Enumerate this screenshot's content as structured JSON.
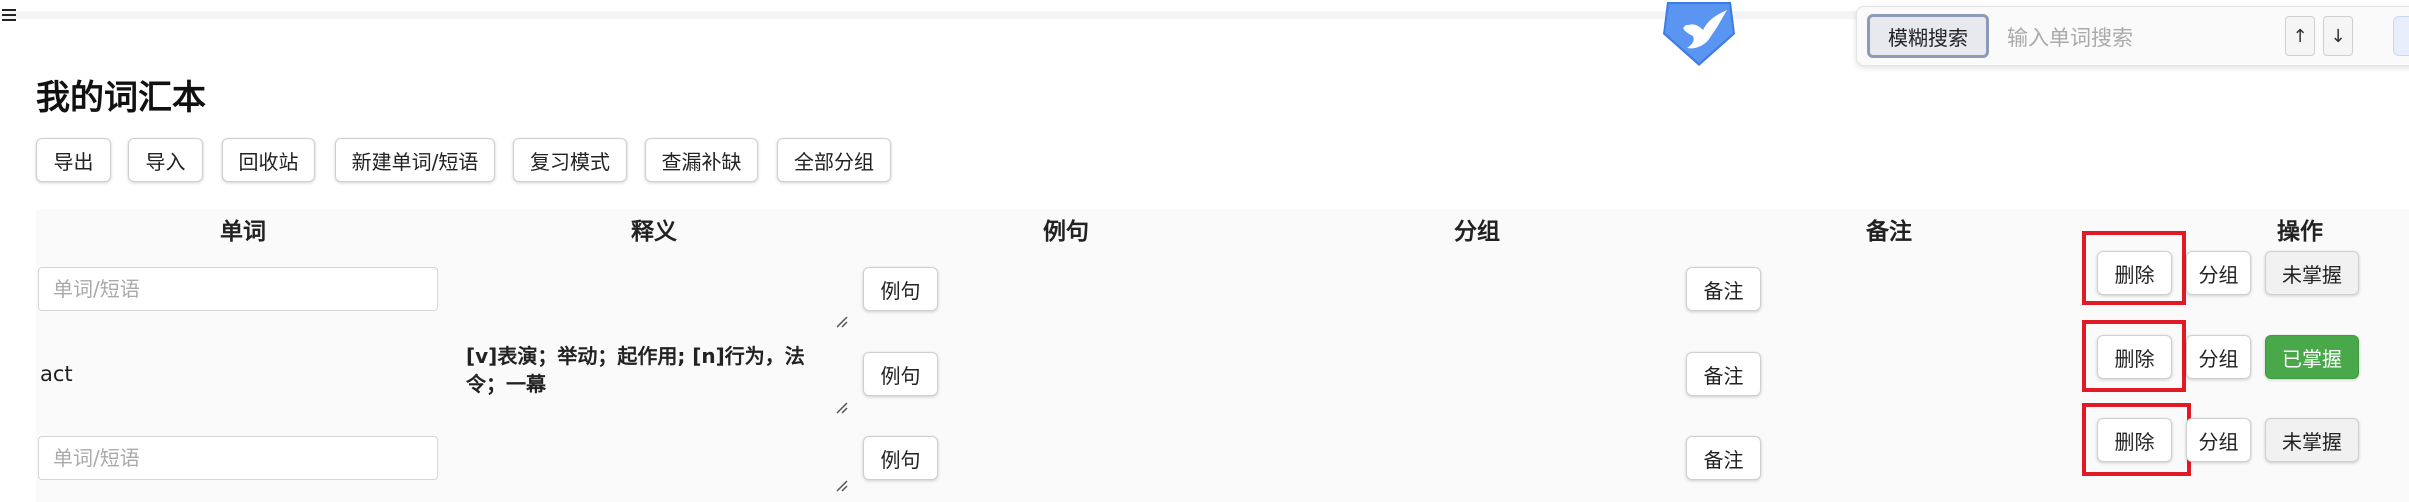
{
  "header": {
    "menu_icon": "hamburger-menu-icon",
    "logo_icon": "bird-shield-logo-icon",
    "search": {
      "fuzzy_label": "模糊搜索",
      "placeholder": "输入单词搜索",
      "up_label": "↑",
      "down_label": "↓"
    }
  },
  "page": {
    "title": "我的词汇本"
  },
  "toolbar": {
    "export": "导出",
    "import": "导入",
    "recycle": "回收站",
    "new_word": "新建单词/短语",
    "review": "复习模式",
    "fill_gaps": "查漏补缺",
    "all_groups": "全部分组"
  },
  "table": {
    "columns": [
      "单词",
      "释义",
      "例句",
      "分组",
      "备注",
      "操作"
    ],
    "rows": [
      {
        "word": "",
        "word_placeholder": "单词/短语",
        "definition": "",
        "example_btn": "例句",
        "note_btn": "备注",
        "delete_btn": "删除",
        "group_btn": "分组",
        "status": "未掌握"
      },
      {
        "word": "act",
        "word_placeholder": "",
        "definition": "[v]表演；举动；起作用; [n]行为，法令；一幕",
        "example_btn": "例句",
        "note_btn": "备注",
        "delete_btn": "删除",
        "group_btn": "分组",
        "status": "已掌握"
      },
      {
        "word": "",
        "word_placeholder": "单词/短语",
        "definition": "",
        "example_btn": "例句",
        "note_btn": "备注",
        "delete_btn": "删除",
        "group_btn": "分组",
        "status": "未掌握"
      }
    ]
  },
  "colors": {
    "mastered": "#48a84a",
    "highlight_frame": "#e01b24",
    "logo_blue": "#3d7be6"
  }
}
